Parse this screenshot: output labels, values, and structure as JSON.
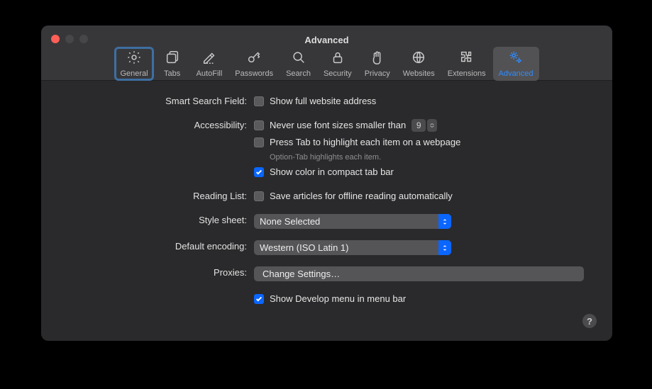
{
  "window": {
    "title": "Advanced"
  },
  "tabs": [
    {
      "label": "General"
    },
    {
      "label": "Tabs"
    },
    {
      "label": "AutoFill"
    },
    {
      "label": "Passwords"
    },
    {
      "label": "Search"
    },
    {
      "label": "Security"
    },
    {
      "label": "Privacy"
    },
    {
      "label": "Websites"
    },
    {
      "label": "Extensions"
    },
    {
      "label": "Advanced"
    }
  ],
  "sections": {
    "smartSearch": {
      "label": "Smart Search Field:",
      "showFullAddress": {
        "label": "Show full website address",
        "checked": false
      }
    },
    "accessibility": {
      "label": "Accessibility:",
      "minFont": {
        "label": "Never use font sizes smaller than",
        "value": "9",
        "checked": false
      },
      "pressTab": {
        "label": "Press Tab to highlight each item on a webpage",
        "checked": false,
        "hint": "Option-Tab highlights each item."
      },
      "colorCompact": {
        "label": "Show color in compact tab bar",
        "checked": true
      }
    },
    "readingList": {
      "label": "Reading List:",
      "saveOffline": {
        "label": "Save articles for offline reading automatically",
        "checked": false
      }
    },
    "styleSheet": {
      "label": "Style sheet:",
      "value": "None Selected"
    },
    "encoding": {
      "label": "Default encoding:",
      "value": "Western (ISO Latin 1)"
    },
    "proxies": {
      "label": "Proxies:",
      "button": "Change Settings…"
    },
    "develop": {
      "label": "Show Develop menu in menu bar",
      "checked": true
    }
  },
  "help": {
    "glyph": "?"
  }
}
